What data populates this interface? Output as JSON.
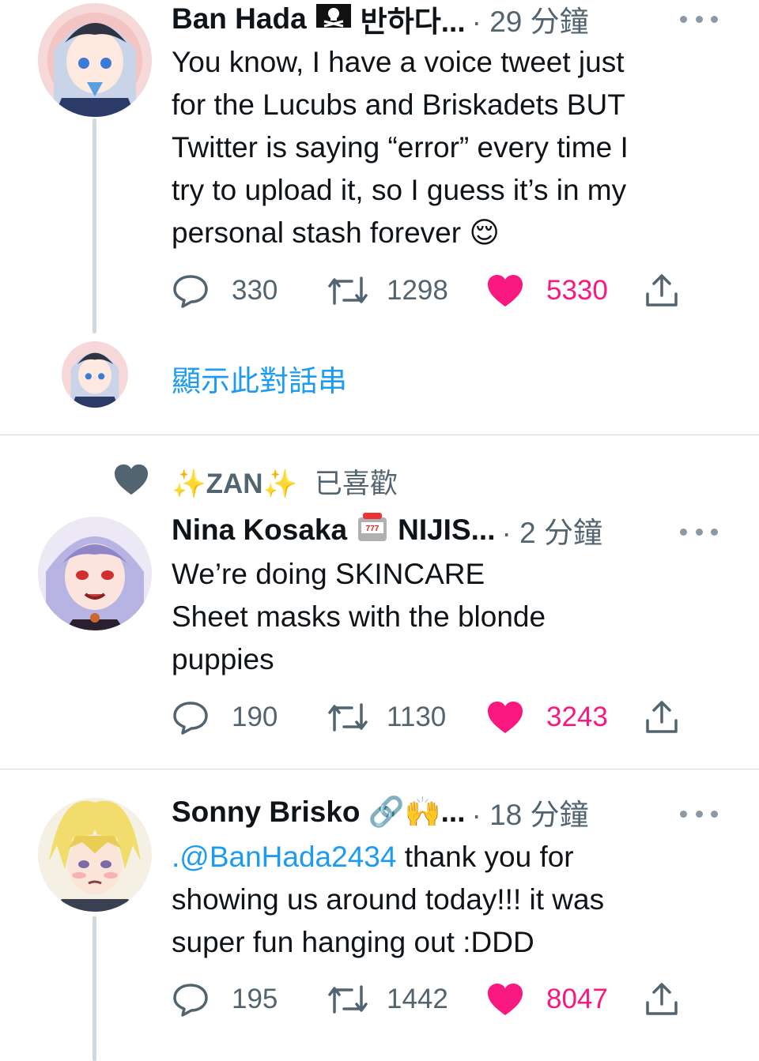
{
  "tweets": [
    {
      "name": "Ban Hada",
      "flag_emoji": "🏴‍☠️",
      "name_rest": "반하다...",
      "time": "· 29 分鐘",
      "text_lines": [
        "You know, I have a voice tweet just",
        "for the Lucubs and Briskadets BUT",
        "Twitter is saying “error” every time I",
        "try to upload it, so I guess it’s in my",
        "personal stash forever 😌"
      ],
      "replies": "330",
      "retweets": "1298",
      "likes": "5330",
      "liked": true,
      "show_thread": "顯示此對話串"
    },
    {
      "liked_by": "✨ZAN✨",
      "liked_label": "已喜歡",
      "name": "Nina Kosaka",
      "emoji": "🎰",
      "name_rest": "NIJIS...",
      "time": "· 2 分鐘",
      "text_lines": [
        "We’re doing SKINCARE",
        "Sheet masks with the blonde",
        "puppies"
      ],
      "replies": "190",
      "retweets": "1130",
      "likes": "3243",
      "liked": true
    },
    {
      "name": "Sonny Brisko",
      "emoji": "🔗🙌...",
      "time": "· 18 分鐘",
      "mention": ".@BanHada2434",
      "text_after_mention": " thank you for",
      "text_lines": [
        "showing us around today!!! it was",
        "super fun hanging out :DDD"
      ],
      "replies": "195",
      "retweets": "1442",
      "likes": "8047",
      "liked": true
    }
  ],
  "colors": {
    "like": "#f91880",
    "link": "#1d9bf0",
    "muted": "#536471",
    "thread_line": "#cfd9de"
  },
  "icons": [
    "reply-icon",
    "retweet-icon",
    "like-icon",
    "share-icon",
    "more-icon",
    "heart-liked-by-icon"
  ]
}
